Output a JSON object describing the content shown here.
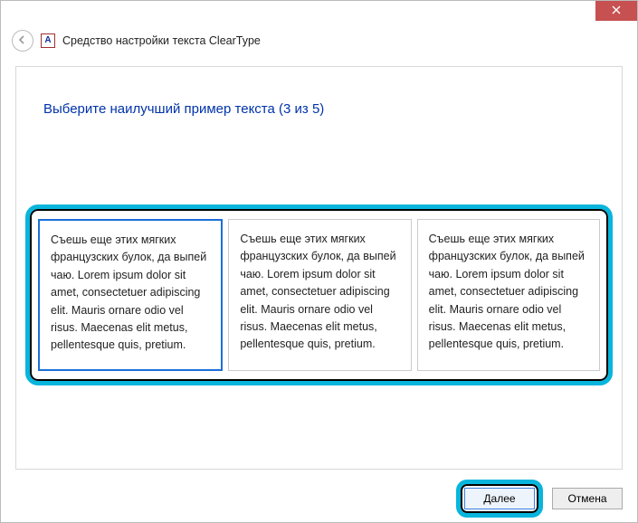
{
  "window": {
    "title": "Средство настройки текста ClearType",
    "icon_letter": "A"
  },
  "instruction": "Выберите наилучший пример текста (3 из 5)",
  "sample_text": "Съешь еще этих мягких французских булок, да выпей чаю. Lorem ipsum dolor sit amet, consectetuer adipiscing elit. Mauris ornare odio vel risus. Maecenas elit metus, pellentesque quis, pretium.",
  "selected_index": 0,
  "buttons": {
    "next": "Далее",
    "cancel": "Отмена"
  },
  "colors": {
    "accent_link": "#0033aa",
    "selection_border": "#1b6fd8",
    "highlight_ring": "#08b5dc",
    "close_bg": "#c75050"
  }
}
